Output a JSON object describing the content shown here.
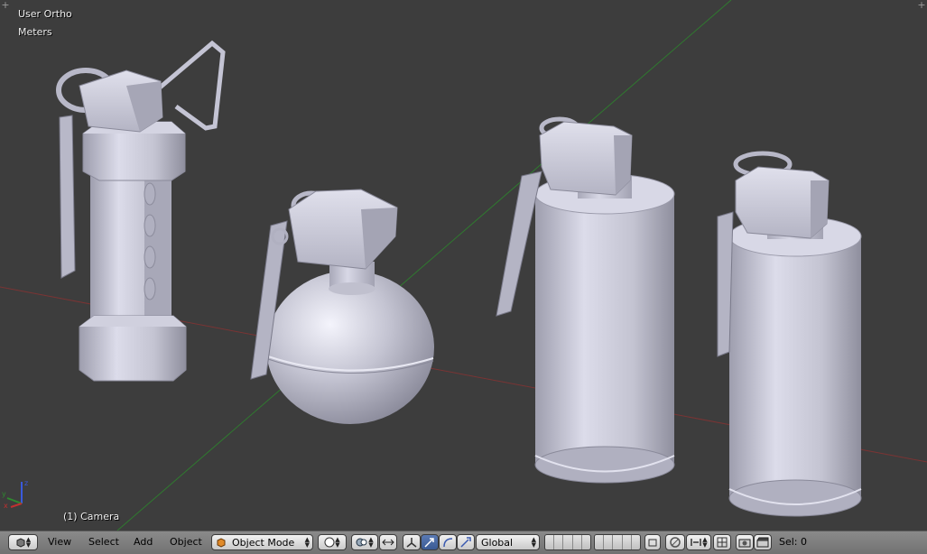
{
  "viewport": {
    "view_name": "User Ortho",
    "units": "Meters",
    "object_label": "(1) Camera",
    "axis_labels": {
      "x": "x",
      "y": "y",
      "z": "z"
    }
  },
  "header": {
    "menus": [
      "View",
      "Select",
      "Add",
      "Object"
    ],
    "mode": "Object Mode",
    "orientation": "Global",
    "selection": "Sel: 0"
  },
  "colors": {
    "background": "#3d3d3d",
    "x_axis": "#8a3a3a",
    "y_axis": "#3a8a3a",
    "mesh": "#c8c8d8",
    "header": "#7a7a7a"
  }
}
